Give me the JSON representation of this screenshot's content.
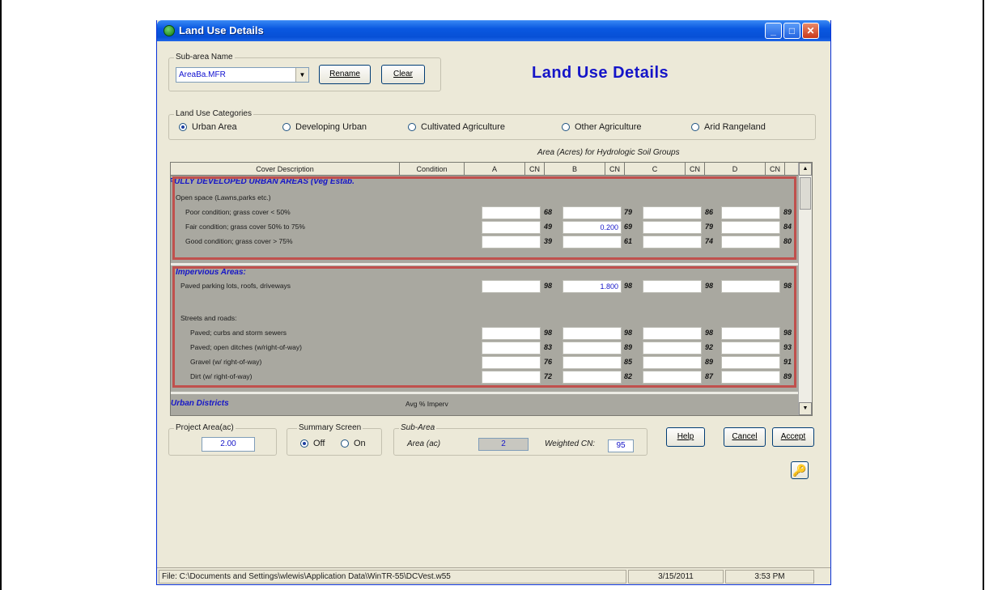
{
  "window": {
    "title": "Land Use Details",
    "title_buttons": [
      "_",
      "□",
      "✕"
    ]
  },
  "subarea": {
    "group_label": "Sub-area Name",
    "selected": "AreaBa.MFR",
    "rename_label": "Rename",
    "clear_label": "Clear"
  },
  "main_title": "Land Use Details",
  "categories": {
    "group_label": "Land Use Categories",
    "options": [
      {
        "label": "Urban Area",
        "selected": true
      },
      {
        "label": "Developing Urban",
        "selected": false
      },
      {
        "label": "Cultivated Agriculture",
        "selected": false
      },
      {
        "label": "Other Agriculture",
        "selected": false
      },
      {
        "label": "Arid Rangeland",
        "selected": false
      }
    ]
  },
  "grid": {
    "caption": "Area (Acres) for Hydrologic Soil Groups",
    "columns": [
      "Cover Description",
      "Condition",
      "A",
      "CN",
      "B",
      "CN",
      "C",
      "CN",
      "D",
      "CN"
    ],
    "section1_title": "FULLY DEVELOPED URBAN AREAS (Veg Estab.",
    "open_space_label": "Open space (Lawns,parks etc.)",
    "rows1": [
      {
        "desc": "Poor condition; grass cover < 50%",
        "a": "",
        "cn_a": "68",
        "b": "",
        "cn_b": "79",
        "c": "",
        "cn_c": "86",
        "d": "",
        "cn_d": "89"
      },
      {
        "desc": "Fair condition; grass cover 50% to 75%",
        "a": "",
        "cn_a": "49",
        "b": "0.200",
        "cn_b": "69",
        "c": "",
        "cn_c": "79",
        "d": "",
        "cn_d": "84"
      },
      {
        "desc": "Good condition; grass cover > 75%",
        "a": "",
        "cn_a": "39",
        "b": "",
        "cn_b": "61",
        "c": "",
        "cn_c": "74",
        "d": "",
        "cn_d": "80"
      }
    ],
    "section2_title": "Impervious Areas:",
    "paved_row": {
      "desc": "Paved parking lots, roofs, driveways",
      "a": "",
      "cn_a": "98",
      "b": "1.800",
      "cn_b": "98",
      "c": "",
      "cn_c": "98",
      "d": "",
      "cn_d": "98"
    },
    "streets_label": "Streets and roads:",
    "rows2": [
      {
        "desc": "Paved; curbs and storm sewers",
        "a": "",
        "cn_a": "98",
        "b": "",
        "cn_b": "98",
        "c": "",
        "cn_c": "98",
        "d": "",
        "cn_d": "98"
      },
      {
        "desc": "Paved; open ditches (w/right-of-way)",
        "a": "",
        "cn_a": "83",
        "b": "",
        "cn_b": "89",
        "c": "",
        "cn_c": "92",
        "d": "",
        "cn_d": "93"
      },
      {
        "desc": "Gravel (w/ right-of-way)",
        "a": "",
        "cn_a": "76",
        "b": "",
        "cn_b": "85",
        "c": "",
        "cn_c": "89",
        "d": "",
        "cn_d": "91"
      },
      {
        "desc": "Dirt   (w/ right-of-way)",
        "a": "",
        "cn_a": "72",
        "b": "",
        "cn_b": "82",
        "c": "",
        "cn_c": "87",
        "d": "",
        "cn_d": "89"
      }
    ],
    "section3_title": "Urban Districts",
    "section3_col": "Avg % Imperv"
  },
  "project_area": {
    "label": "Project Area(ac)",
    "value": "2.00"
  },
  "summary": {
    "label": "Summary Screen",
    "off": "Off",
    "on": "On",
    "off_selected": true
  },
  "subarea_summary": {
    "label": "Sub-Area",
    "area_label": "Area (ac)",
    "area_value": "2",
    "cn_label": "Weighted CN:",
    "cn_value": "95"
  },
  "buttons": {
    "help": "Help",
    "cancel": "Cancel",
    "accept": "Accept"
  },
  "status": {
    "path": "File: C:\\Documents and Settings\\wlewis\\Application Data\\WinTR-55\\DCVest.w55",
    "date": "3/15/2011",
    "time": "3:53 PM"
  },
  "icons": [
    "app-icon",
    "minimize-icon",
    "maximize-icon",
    "close-icon",
    "dropdown-arrow-icon",
    "scroll-up-icon",
    "scroll-down-icon",
    "key-icon"
  ],
  "colors": {
    "title_blue": "#1515c8",
    "highlight_red": "#c0504d",
    "grid_gray": "#a9a8a0"
  }
}
